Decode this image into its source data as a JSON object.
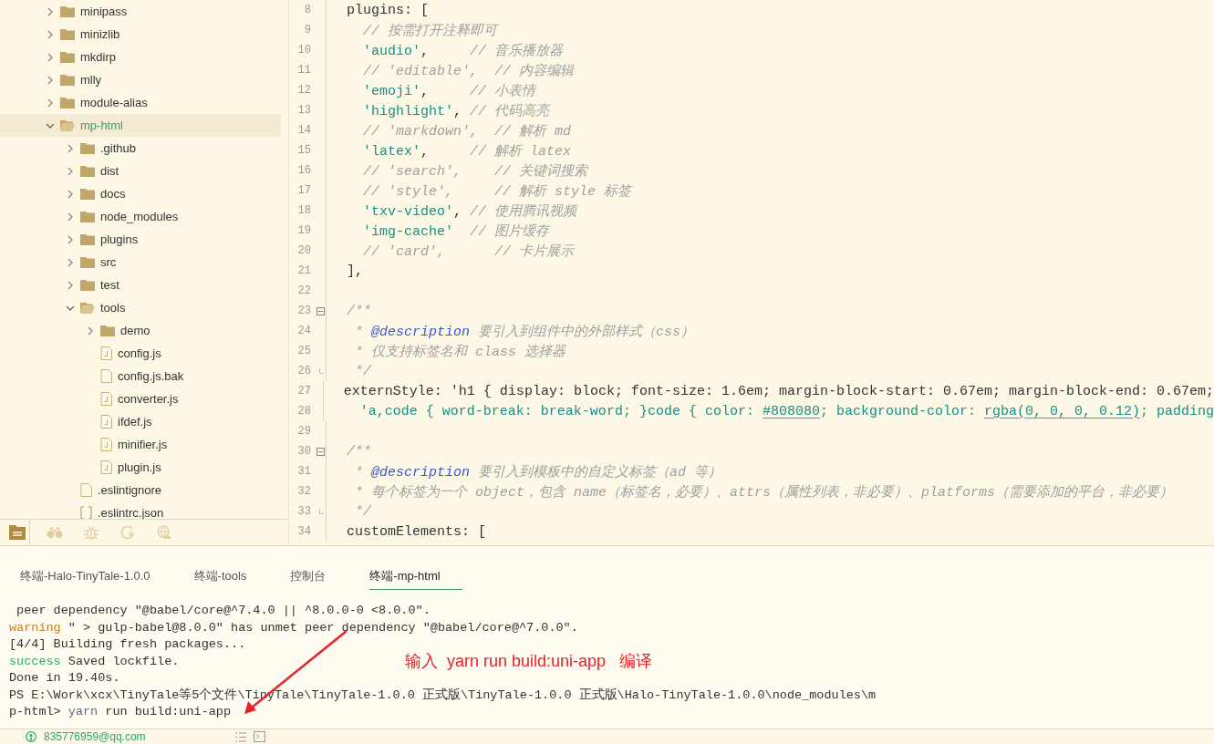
{
  "sidebar": {
    "tree": [
      {
        "kind": "folder",
        "label": "minipass",
        "expanded": false,
        "selected": false
      },
      {
        "kind": "folder",
        "label": "minizlib",
        "expanded": false,
        "selected": false
      },
      {
        "kind": "folder",
        "label": "mkdirp",
        "expanded": false,
        "selected": false
      },
      {
        "kind": "folder",
        "label": "mlly",
        "expanded": false,
        "selected": false
      },
      {
        "kind": "folder",
        "label": "module-alias",
        "expanded": false,
        "selected": false
      },
      {
        "kind": "folder",
        "label": "mp-html",
        "expanded": true,
        "selected": true,
        "children": [
          {
            "kind": "folder",
            "label": ".github",
            "expanded": false,
            "selected": false
          },
          {
            "kind": "folder",
            "label": "dist",
            "expanded": false,
            "selected": false
          },
          {
            "kind": "folder",
            "label": "docs",
            "expanded": false,
            "selected": false
          },
          {
            "kind": "folder",
            "label": "node_modules",
            "expanded": false,
            "selected": false
          },
          {
            "kind": "folder",
            "label": "plugins",
            "expanded": false,
            "selected": false
          },
          {
            "kind": "folder",
            "label": "src",
            "expanded": false,
            "selected": false
          },
          {
            "kind": "folder",
            "label": "test",
            "expanded": false,
            "selected": false
          },
          {
            "kind": "folder",
            "label": "tools",
            "expanded": true,
            "selected": false,
            "children": [
              {
                "kind": "folder",
                "label": "demo",
                "expanded": false,
                "selected": false
              },
              {
                "kind": "js",
                "label": "config.js",
                "selected": false
              },
              {
                "kind": "file",
                "label": "config.js.bak",
                "selected": false
              },
              {
                "kind": "js",
                "label": "converter.js",
                "selected": false
              },
              {
                "kind": "js",
                "label": "ifdef.js",
                "selected": false
              },
              {
                "kind": "js",
                "label": "minifier.js",
                "selected": false
              },
              {
                "kind": "js",
                "label": "plugin.js",
                "selected": false
              }
            ]
          },
          {
            "kind": "file",
            "label": ".eslintignore",
            "selected": false
          },
          {
            "kind": "json",
            "label": ".eslintrc.json",
            "selected": false
          }
        ]
      }
    ],
    "toolbar": [
      {
        "kind": "files",
        "selected": true
      },
      {
        "kind": "binoculars",
        "selected": false
      },
      {
        "kind": "bug",
        "selected": false
      },
      {
        "kind": "sync",
        "selected": false
      },
      {
        "kind": "globe",
        "selected": false
      }
    ]
  },
  "editor": {
    "lines": [
      {
        "number": "8",
        "kind": "code",
        "segments": [
          {
            "kind": "plain",
            "text": "plugins: ["
          }
        ]
      },
      {
        "number": "9",
        "kind": "code",
        "segments": [
          {
            "kind": "comment",
            "text": "  // 按需打开注释即可"
          }
        ]
      },
      {
        "number": "10",
        "kind": "code",
        "segments": [
          {
            "kind": "string",
            "text": "  'audio'"
          },
          {
            "kind": "plain",
            "text": ","
          },
          {
            "kind": "comment",
            "text": "     // 音乐播放器"
          }
        ]
      },
      {
        "number": "11",
        "kind": "code",
        "segments": [
          {
            "kind": "comment",
            "text": "  // 'editable',  // 内容编辑"
          }
        ]
      },
      {
        "number": "12",
        "kind": "code",
        "segments": [
          {
            "kind": "string",
            "text": "  'emoji'"
          },
          {
            "kind": "plain",
            "text": ","
          },
          {
            "kind": "comment",
            "text": "     // 小表情"
          }
        ]
      },
      {
        "number": "13",
        "kind": "code",
        "segments": [
          {
            "kind": "string",
            "text": "  'highlight'"
          },
          {
            "kind": "plain",
            "text": ","
          },
          {
            "kind": "comment",
            "text": " // 代码高亮"
          }
        ]
      },
      {
        "number": "14",
        "kind": "code",
        "segments": [
          {
            "kind": "comment",
            "text": "  // 'markdown',  // 解析 md"
          }
        ]
      },
      {
        "number": "15",
        "kind": "code",
        "segments": [
          {
            "kind": "string",
            "text": "  'latex'"
          },
          {
            "kind": "plain",
            "text": ","
          },
          {
            "kind": "comment",
            "text": "     // 解析 latex"
          }
        ]
      },
      {
        "number": "16",
        "kind": "code",
        "segments": [
          {
            "kind": "comment",
            "text": "  // 'search',    // 关键词搜索"
          }
        ]
      },
      {
        "number": "17",
        "kind": "code",
        "segments": [
          {
            "kind": "comment",
            "text": "  // 'style',     // 解析 style 标签"
          }
        ]
      },
      {
        "number": "18",
        "kind": "code",
        "segments": [
          {
            "kind": "string",
            "text": "  'txv-video'"
          },
          {
            "kind": "plain",
            "text": ","
          },
          {
            "kind": "comment",
            "text": " // 使用腾讯视频"
          }
        ]
      },
      {
        "number": "19",
        "kind": "code",
        "segments": [
          {
            "kind": "string",
            "text": "  'img-cache'"
          },
          {
            "kind": "comment",
            "text": "  // 图片缓存"
          }
        ]
      },
      {
        "number": "20",
        "kind": "code",
        "segments": [
          {
            "kind": "comment",
            "text": "  // 'card',      // 卡片展示"
          }
        ]
      },
      {
        "number": "21",
        "kind": "code",
        "segments": [
          {
            "kind": "plain",
            "text": "],"
          }
        ]
      },
      {
        "number": "22",
        "kind": "code"
      },
      {
        "number": "23",
        "kind": "fold_start",
        "expanded": true,
        "segments": [
          {
            "kind": "comment",
            "text": "/**"
          }
        ]
      },
      {
        "number": "24",
        "kind": "code",
        "segments": [
          {
            "kind": "comment",
            "text": " * "
          },
          {
            "kind": "tag",
            "text": "@description"
          },
          {
            "kind": "comment",
            "text": " 要引入到组件中的外部样式（css）"
          }
        ]
      },
      {
        "number": "25",
        "kind": "code",
        "segments": [
          {
            "kind": "comment",
            "text": " * 仅支持标签名和 class 选择器"
          }
        ]
      },
      {
        "number": "26",
        "kind": "fold_end",
        "segments": [
          {
            "kind": "comment",
            "text": " */"
          }
        ]
      },
      {
        "number": "27",
        "kind": "code",
        "segments": [
          {
            "kind": "plain",
            "text": "externStyle: 'h1 { display: block; font-size: 1.6em; margin-block-start: 0.67em; margin-block-end: 0.67em;"
          }
        ]
      },
      {
        "number": "28",
        "kind": "code",
        "segments": [
          {
            "kind": "string",
            "text": "  'a,code { word-break: break-word; }code { color: "
          },
          {
            "kind": "color",
            "text": "#808080"
          },
          {
            "kind": "string",
            "text": "; background-color: "
          },
          {
            "kind": "color",
            "text": "rgba(0, 0, 0, 0.12)"
          },
          {
            "kind": "string",
            "text": "; padding"
          }
        ]
      },
      {
        "number": "29",
        "kind": "code"
      },
      {
        "number": "30",
        "kind": "fold_start",
        "expanded": true,
        "segments": [
          {
            "kind": "comment",
            "text": "/**"
          }
        ]
      },
      {
        "number": "31",
        "kind": "code",
        "segments": [
          {
            "kind": "comment",
            "text": " * "
          },
          {
            "kind": "tag",
            "text": "@description"
          },
          {
            "kind": "comment",
            "text": " 要引入到模板中的自定义标签（ad 等）"
          }
        ]
      },
      {
        "number": "32",
        "kind": "code",
        "segments": [
          {
            "kind": "comment",
            "text": " * 每个标签为一个 object，包含 name（标签名，必要）、attrs（属性列表，非必要）、platforms（需要添加的平台，非必要）"
          }
        ]
      },
      {
        "number": "33",
        "kind": "fold_end",
        "segments": [
          {
            "kind": "comment",
            "text": " */"
          }
        ]
      },
      {
        "number": "34",
        "kind": "code",
        "segments": [
          {
            "kind": "plain",
            "text": "customElements: ["
          }
        ]
      }
    ]
  },
  "terminal": {
    "tabs": [
      {
        "label": "终端-Halo-TinyTale-1.0.0",
        "selected": false
      },
      {
        "label": "终端-tools",
        "selected": false
      },
      {
        "label": "控制台",
        "selected": false
      },
      {
        "label": "终端-mp-html",
        "selected": true
      }
    ],
    "lines": [
      [
        {
          "kind": "plain",
          "text": " peer dependency \"@babel/core@^7.4.0 || ^8.0.0-0 <8.0.0\"."
        }
      ],
      [
        {
          "kind": "warning",
          "text": "warning"
        },
        {
          "kind": "plain",
          "text": " \" > gulp-babel@8.0.0\" has unmet peer dependency \"@babel/core@^7.0.0\"."
        }
      ],
      [
        {
          "kind": "plain",
          "text": "[4/4] Building fresh packages..."
        }
      ],
      [
        {
          "kind": "success",
          "text": "success"
        },
        {
          "kind": "plain",
          "text": " Saved lockfile."
        }
      ],
      [
        {
          "kind": "plain",
          "text": "Done in 19.40s."
        }
      ],
      [
        {
          "kind": "plain",
          "text": "PS E:\\Work\\xcx\\TinyTale等5个文件\\TinyTale\\TinyTale-1.0.0 正式版\\TinyTale-1.0.0 正式版\\Halo-TinyTale-1.0.0\\node_modules\\m"
        }
      ],
      [
        {
          "kind": "plain",
          "text": "p-html> "
        },
        {
          "kind": "command",
          "text": "yarn"
        },
        {
          "kind": "plain",
          "text": " run build:uni-app"
        }
      ]
    ],
    "annotation": "输入  yarn run build:uni-app   编译"
  },
  "status_bar": {
    "account": "835776959@qq.com"
  }
}
